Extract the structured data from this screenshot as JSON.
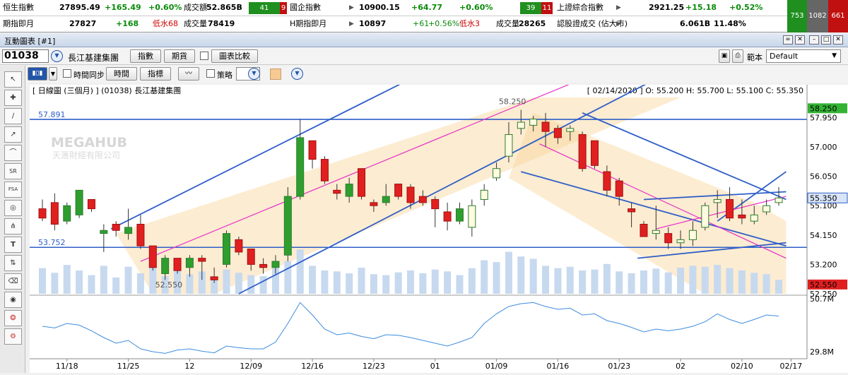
{
  "ticker": {
    "row1": [
      {
        "label": "恒生指數",
        "value": "27895.49",
        "change": "+165.49",
        "pct": "+0.60%",
        "extra_label": "成交額",
        "extra_value": "52.865B",
        "up": "41",
        "down": "9"
      },
      {
        "label": "國企指數",
        "value": "10900.15",
        "change": "+64.77",
        "pct": "+0.60%",
        "up": "39",
        "down": "11"
      },
      {
        "label": "上證綜合指數",
        "value": "2921.25",
        "change": "+15.18",
        "pct": "+0.52%",
        "up": "753",
        "flat": "1082",
        "down": "661"
      }
    ],
    "row2": [
      {
        "label": "期指即月",
        "value": "27827",
        "change": "+168",
        "note": "低水68",
        "extra_label": "成交量",
        "extra_value": "78419"
      },
      {
        "label": "H期指即月",
        "value": "10897",
        "change": "+61",
        "pct": "+0.56%",
        "note": "低水3",
        "extra_label": "成交量",
        "extra_value": "28265"
      },
      {
        "label": "認股證成交 (佔大市)",
        "value": "6.061B",
        "pct": "11.48%"
      }
    ]
  },
  "window": {
    "title": "互動圖表 [#1]"
  },
  "toolbar": {
    "code": "01038",
    "name": "長江基建集團",
    "btn_index": "指數",
    "btn_futures": "期貨",
    "btn_compare": "圖表比較",
    "template_label": "範本",
    "template_value": "Default",
    "time_sync": "時間同步",
    "btn_time": "時間",
    "btn_indicator": "指標",
    "strategy": "策略"
  },
  "left_tools": [
    "↖",
    "✚",
    "∕",
    "↗",
    "⌒",
    "SR",
    "FSA",
    "◎",
    "⋔",
    "T",
    "⇅",
    "⌫",
    "◉",
    "❂",
    "⚙"
  ],
  "chart_header": {
    "left": "[ 日線圖 (三個月) ] (01038)  長江基建集團",
    "right": "[ 02/14/2020 ]  O: 55.200  H: 55.700  L: 55.100  C: 55.350"
  },
  "watermark": {
    "title": "MEGAHUB",
    "sub": "天滙財經有限公司"
  },
  "colors": {
    "up_green": "#2e9e2e",
    "down_red": "#e02020",
    "trend_blue": "#2f5fc8",
    "pink": "#e62ec9",
    "channel_fill": "#f8d49a",
    "vol_bar": "#c7d9ef",
    "osc": "#3d8de0"
  },
  "chart_data": {
    "type": "candlestick",
    "price_ylim": [
      52.25,
      58.6
    ],
    "price_ticks": [
      "58.250",
      "57.950",
      "57.000",
      "56.050",
      "55.100",
      "54.150",
      "53.200",
      "52.250"
    ],
    "osc_ticks": [
      "50.7M",
      "29.8M"
    ],
    "x_ticks": [
      "11/18",
      "11/25",
      "12",
      "12/09",
      "12/16",
      "12/23",
      "01",
      "01/09",
      "01/16",
      "01/23",
      "02",
      "02/10",
      "02/17"
    ],
    "hlines": [
      {
        "label": "57.891",
        "value": 57.891
      },
      {
        "label": "53.752",
        "value": 53.752
      }
    ],
    "annotations": [
      {
        "text": "58.250"
      },
      {
        "text": "52.550"
      }
    ],
    "last_price": "55.350",
    "highlight_high": "58.250",
    "highlight_low": "52.550",
    "candles": [
      [
        55.0,
        55.3,
        54.6,
        54.7
      ],
      [
        55.2,
        55.5,
        54.3,
        54.5
      ],
      [
        54.6,
        55.2,
        54.5,
        55.1
      ],
      [
        54.8,
        55.6,
        54.7,
        55.6
      ],
      [
        55.3,
        55.3,
        54.9,
        55.0
      ],
      [
        54.2,
        54.5,
        53.6,
        54.3
      ],
      [
        54.5,
        54.6,
        54.1,
        54.3
      ],
      [
        54.2,
        55.0,
        54.0,
        54.4
      ],
      [
        54.5,
        54.8,
        53.7,
        53.8
      ],
      [
        53.8,
        53.8,
        53.0,
        53.1
      ],
      [
        52.9,
        53.5,
        52.7,
        53.4
      ],
      [
        53.4,
        53.4,
        52.9,
        53.0
      ],
      [
        53.1,
        53.5,
        52.8,
        53.4
      ],
      [
        53.4,
        53.5,
        52.7,
        53.3
      ],
      [
        52.8,
        53.1,
        52.6,
        52.7
      ],
      [
        53.2,
        54.3,
        53.1,
        54.2
      ],
      [
        54.0,
        54.1,
        53.5,
        53.6
      ],
      [
        53.7,
        53.7,
        53.0,
        53.2
      ],
      [
        53.2,
        53.4,
        52.9,
        53.1
      ],
      [
        53.1,
        53.5,
        52.9,
        53.3
      ],
      [
        53.5,
        55.7,
        53.3,
        55.4
      ],
      [
        55.4,
        57.9,
        55.3,
        57.3
      ],
      [
        57.2,
        57.2,
        56.3,
        56.6
      ],
      [
        56.6,
        56.7,
        55.8,
        55.9
      ],
      [
        55.6,
        55.8,
        55.3,
        55.5
      ],
      [
        55.4,
        56.0,
        55.2,
        55.8
      ],
      [
        56.3,
        56.3,
        55.3,
        55.4
      ],
      [
        55.2,
        55.3,
        54.9,
        55.1
      ],
      [
        55.2,
        55.8,
        55.1,
        55.4
      ],
      [
        55.8,
        55.8,
        55.3,
        55.4
      ],
      [
        55.7,
        55.8,
        55.0,
        55.2
      ],
      [
        55.4,
        55.6,
        55.1,
        55.2
      ],
      [
        55.3,
        55.4,
        54.4,
        55.0
      ],
      [
        54.9,
        55.2,
        54.3,
        54.6
      ],
      [
        54.6,
        55.2,
        54.5,
        55.0
      ],
      [
        54.4,
        55.3,
        54.1,
        55.1
      ],
      [
        55.3,
        55.8,
        55.1,
        55.6
      ],
      [
        56.0,
        56.5,
        55.9,
        56.3
      ],
      [
        56.7,
        57.8,
        56.5,
        57.4
      ],
      [
        57.6,
        58.2,
        57.4,
        57.8
      ],
      [
        57.7,
        58.0,
        57.5,
        57.9
      ],
      [
        57.8,
        58.1,
        57.0,
        57.5
      ],
      [
        57.6,
        57.7,
        57.1,
        57.3
      ],
      [
        57.5,
        57.7,
        57.2,
        57.6
      ],
      [
        57.4,
        57.5,
        56.2,
        56.3
      ],
      [
        57.2,
        57.2,
        56.3,
        56.4
      ],
      [
        56.2,
        56.4,
        55.4,
        55.6
      ],
      [
        55.9,
        56.0,
        55.1,
        55.4
      ],
      [
        55.0,
        55.2,
        54.4,
        54.9
      ],
      [
        54.5,
        54.6,
        54.1,
        54.1
      ],
      [
        54.2,
        55.1,
        54.0,
        54.3
      ],
      [
        54.2,
        54.4,
        53.7,
        53.9
      ],
      [
        53.9,
        54.3,
        53.7,
        54.0
      ],
      [
        54.0,
        54.6,
        53.8,
        54.3
      ],
      [
        54.4,
        55.2,
        54.3,
        55.1
      ],
      [
        55.2,
        55.6,
        54.7,
        55.3
      ],
      [
        55.3,
        55.7,
        54.6,
        54.7
      ],
      [
        54.8,
        55.3,
        54.5,
        54.7
      ],
      [
        54.6,
        55.1,
        54.5,
        54.8
      ],
      [
        54.9,
        55.3,
        54.8,
        55.1
      ],
      [
        55.2,
        55.7,
        55.1,
        55.35
      ]
    ],
    "volume_relative": [
      0.55,
      0.45,
      0.62,
      0.5,
      0.4,
      0.6,
      0.35,
      0.58,
      0.44,
      0.65,
      0.38,
      0.5,
      0.42,
      0.48,
      0.36,
      0.52,
      0.45,
      0.4,
      0.38,
      0.55,
      0.7,
      0.95,
      0.6,
      0.5,
      0.48,
      0.44,
      0.56,
      0.42,
      0.4,
      0.46,
      0.5,
      0.44,
      0.52,
      0.48,
      0.4,
      0.55,
      0.72,
      0.68,
      0.9,
      0.8,
      0.75,
      0.6,
      0.55,
      0.58,
      0.5,
      0.52,
      0.64,
      0.48,
      0.44,
      0.5,
      0.54,
      0.46,
      0.56,
      0.6,
      0.58,
      0.62,
      0.55,
      0.5,
      0.45,
      0.42,
      0.3
    ],
    "oscillator_relative": [
      0.5,
      0.47,
      0.55,
      0.52,
      0.42,
      0.3,
      0.2,
      0.25,
      0.1,
      0.05,
      0.02,
      0.08,
      0.1,
      0.06,
      0.03,
      0.15,
      0.12,
      0.1,
      0.1,
      0.22,
      0.55,
      0.92,
      0.7,
      0.45,
      0.35,
      0.38,
      0.32,
      0.28,
      0.35,
      0.34,
      0.3,
      0.25,
      0.2,
      0.15,
      0.22,
      0.3,
      0.55,
      0.72,
      0.85,
      0.9,
      0.92,
      0.85,
      0.8,
      0.82,
      0.7,
      0.72,
      0.6,
      0.55,
      0.48,
      0.4,
      0.45,
      0.42,
      0.45,
      0.5,
      0.58,
      0.72,
      0.62,
      0.55,
      0.62,
      0.7,
      0.68
    ]
  }
}
